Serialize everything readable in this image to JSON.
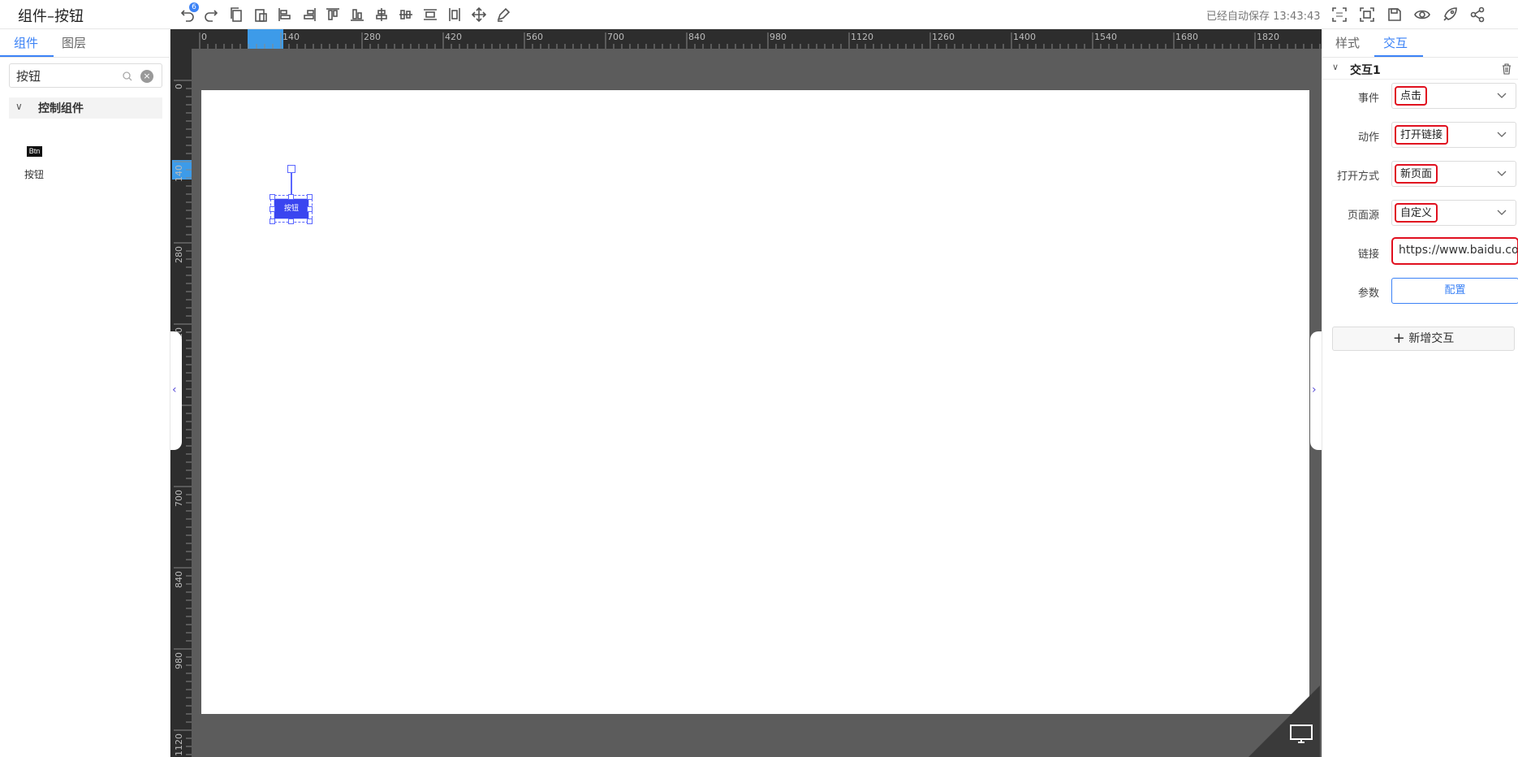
{
  "app": {
    "title": "组件–按钮",
    "autosave": "已经自动保存 13:43:43",
    "undo_count": "6"
  },
  "left_panel": {
    "tabs": [
      "组件",
      "图层"
    ],
    "search": {
      "value": "按钮"
    },
    "category": "控制组件",
    "component": {
      "thumb_text": "Btn",
      "label": "按钮"
    }
  },
  "canvas": {
    "ruler_x": [
      "0",
      "140",
      "280",
      "420",
      "560",
      "700",
      "840",
      "980",
      "1120",
      "1260",
      "1400",
      "1540",
      "1680",
      "1820"
    ],
    "ruler_y": [
      "0",
      "140",
      "280",
      "420",
      "560",
      "700",
      "840",
      "980",
      "1120"
    ],
    "selected_button_text": "按钮"
  },
  "right_panel": {
    "tabs": [
      "样式",
      "交互"
    ],
    "interaction_title": "交互1",
    "props": {
      "event_label": "事件",
      "event_value": "点击",
      "action_label": "动作",
      "action_value": "打开链接",
      "open_mode_label": "打开方式",
      "open_mode_value": "新页面",
      "page_source_label": "页面源",
      "page_source_value": "自定义",
      "link_label": "链接",
      "link_value": "https://www.baidu.com",
      "params_label": "参数",
      "config_button": "配置"
    },
    "add_interaction": "新增交互"
  },
  "colors": {
    "accent": "#3b82f6",
    "highlight": "#e0101f",
    "canvas_bg": "#5c5c5c",
    "ruler_bg": "#2d2d2d",
    "button_fill": "#3a45f0"
  },
  "icons": [
    "undo-icon",
    "redo-icon",
    "copy-icon",
    "paste-icon",
    "align-left-icon",
    "align-right-icon",
    "align-top-icon",
    "align-bottom-icon",
    "align-hcenter-icon",
    "align-vcenter-icon",
    "distribute-h-icon",
    "distribute-v-icon",
    "move-icon",
    "edit-icon",
    "resolution-icon",
    "fit-screen-icon",
    "save-icon",
    "preview-icon",
    "publish-icon",
    "share-icon"
  ]
}
